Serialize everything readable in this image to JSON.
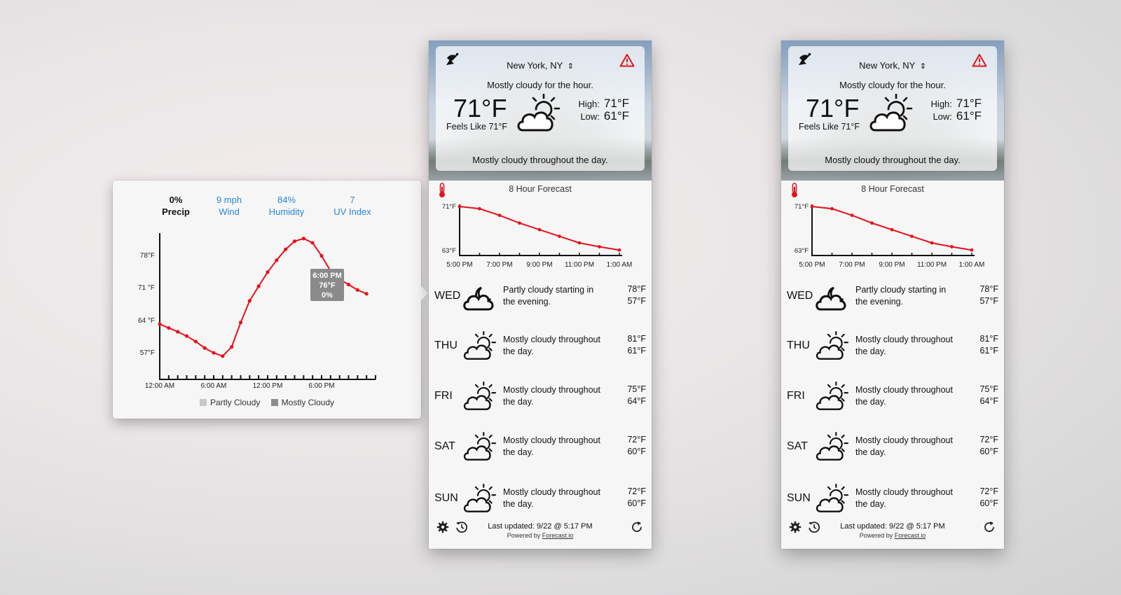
{
  "popover": {
    "stats": [
      {
        "value": "0%",
        "label": "Precip"
      },
      {
        "value": "9 mph",
        "label": "Wind"
      },
      {
        "value": "84%",
        "label": "Humidity"
      },
      {
        "value": "7",
        "label": "UV Index"
      }
    ],
    "legend": [
      {
        "label": "Partly Cloudy",
        "color": "#c8c8c8"
      },
      {
        "label": "Mostly Cloudy",
        "color": "#8e8e8e"
      }
    ],
    "tooltip": {
      "time": "6:00 PM",
      "temp": "76°F",
      "precip": "0%"
    }
  },
  "panel": {
    "location": "New York, NY",
    "summary_hour": "Mostly cloudy for the hour.",
    "temperature": "71°F",
    "feels_like": "Feels Like 71°F",
    "high_label": "High:",
    "high_value": "71°F",
    "low_label": "Low:",
    "low_value": "61°F",
    "summary_day": "Mostly cloudy throughout the day.",
    "forecast_title": "8 Hour Forecast",
    "days": [
      {
        "name": "WED",
        "desc": "Partly cloudy starting in the evening.",
        "hi": "78°F",
        "lo": "57°F",
        "icon": "partly-cloudy-night-icon"
      },
      {
        "name": "THU",
        "desc": "Mostly cloudy throughout the day.",
        "hi": "81°F",
        "lo": "61°F",
        "icon": "partly-cloudy-day-icon"
      },
      {
        "name": "FRI",
        "desc": "Mostly cloudy throughout the day.",
        "hi": "75°F",
        "lo": "64°F",
        "icon": "partly-cloudy-day-icon"
      },
      {
        "name": "SAT",
        "desc": "Mostly cloudy throughout the day.",
        "hi": "72°F",
        "lo": "60°F",
        "icon": "partly-cloudy-day-icon"
      },
      {
        "name": "SUN",
        "desc": "Mostly cloudy throughout the day.",
        "hi": "72°F",
        "lo": "60°F",
        "icon": "partly-cloudy-day-icon"
      }
    ],
    "last_updated": "Last updated: 9/22 @ 5:17 PM",
    "powered_by": "Powered by",
    "powered_link": "Forecast.io"
  },
  "chart_data": [
    {
      "type": "line",
      "x_labels": [
        "12:00 AM",
        "6:00 AM",
        "12:00 PM",
        "6:00 PM"
      ],
      "y_labels": [
        "78°F",
        "71 °F",
        "64 °F",
        "57°F"
      ],
      "ylim": [
        54,
        81
      ],
      "x_hours": [
        0,
        1,
        2,
        3,
        4,
        5,
        6,
        7,
        8,
        9,
        10,
        11,
        12,
        13,
        14,
        15,
        16,
        17,
        18,
        19,
        20,
        21,
        22,
        23
      ],
      "values": [
        64.2,
        63.5,
        62.8,
        62.0,
        61.0,
        59.8,
        58.9,
        58.3,
        60.0,
        64.5,
        68.5,
        71.2,
        73.8,
        76.0,
        78.0,
        79.5,
        80.0,
        79.2,
        76.8,
        74.0,
        72.5,
        71.5,
        70.5,
        69.8
      ],
      "series_color": "#e8101b",
      "grid": false
    },
    {
      "type": "line",
      "x_labels": [
        "5:00 PM",
        "7:00 PM",
        "9:00 PM",
        "11:00 PM",
        "1:00 AM"
      ],
      "y_labels": [
        "71°F",
        "63°F"
      ],
      "ylim": [
        63,
        71
      ],
      "values": [
        71,
        70.6,
        69.4,
        68.0,
        66.8,
        65.6,
        64.4,
        63.7,
        63.1
      ],
      "series_color": "#e8101b",
      "grid": false
    }
  ]
}
